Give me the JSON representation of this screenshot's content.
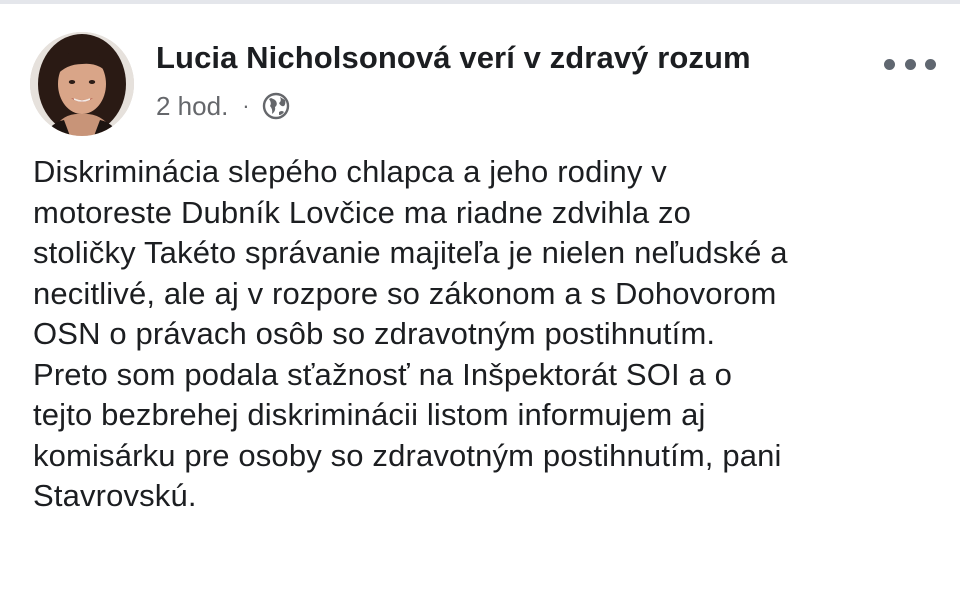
{
  "post": {
    "author": "Lucia Nicholsonová verí v zdravý rozum",
    "time": "2 hod.",
    "separator": "·",
    "audience_icon": "globe-icon",
    "menu_icon": "more-options-icon",
    "text_lines": [
      "Diskriminácia slepého chlapca a jeho rodiny v",
      "motoreste Dubník Lovčice ma riadne zdvihla zo",
      "stoličky Takéto správanie majiteľa je nielen neľudské a",
      "necitlivé, ale aj v rozpore so zákonom a s Dohovorom",
      "OSN o právach osôb so zdravotným postihnutím.",
      "Preto som podala sťažnosť na Inšpektorát SOI a o",
      "tejto bezbrehej diskriminácii listom informujem aj",
      "komisárku pre osoby so zdravotným postihnutím, pani",
      "Stavrovskú."
    ]
  },
  "colors": {
    "text": "#1c1e21",
    "meta": "#65676b",
    "background": "#ffffff"
  }
}
